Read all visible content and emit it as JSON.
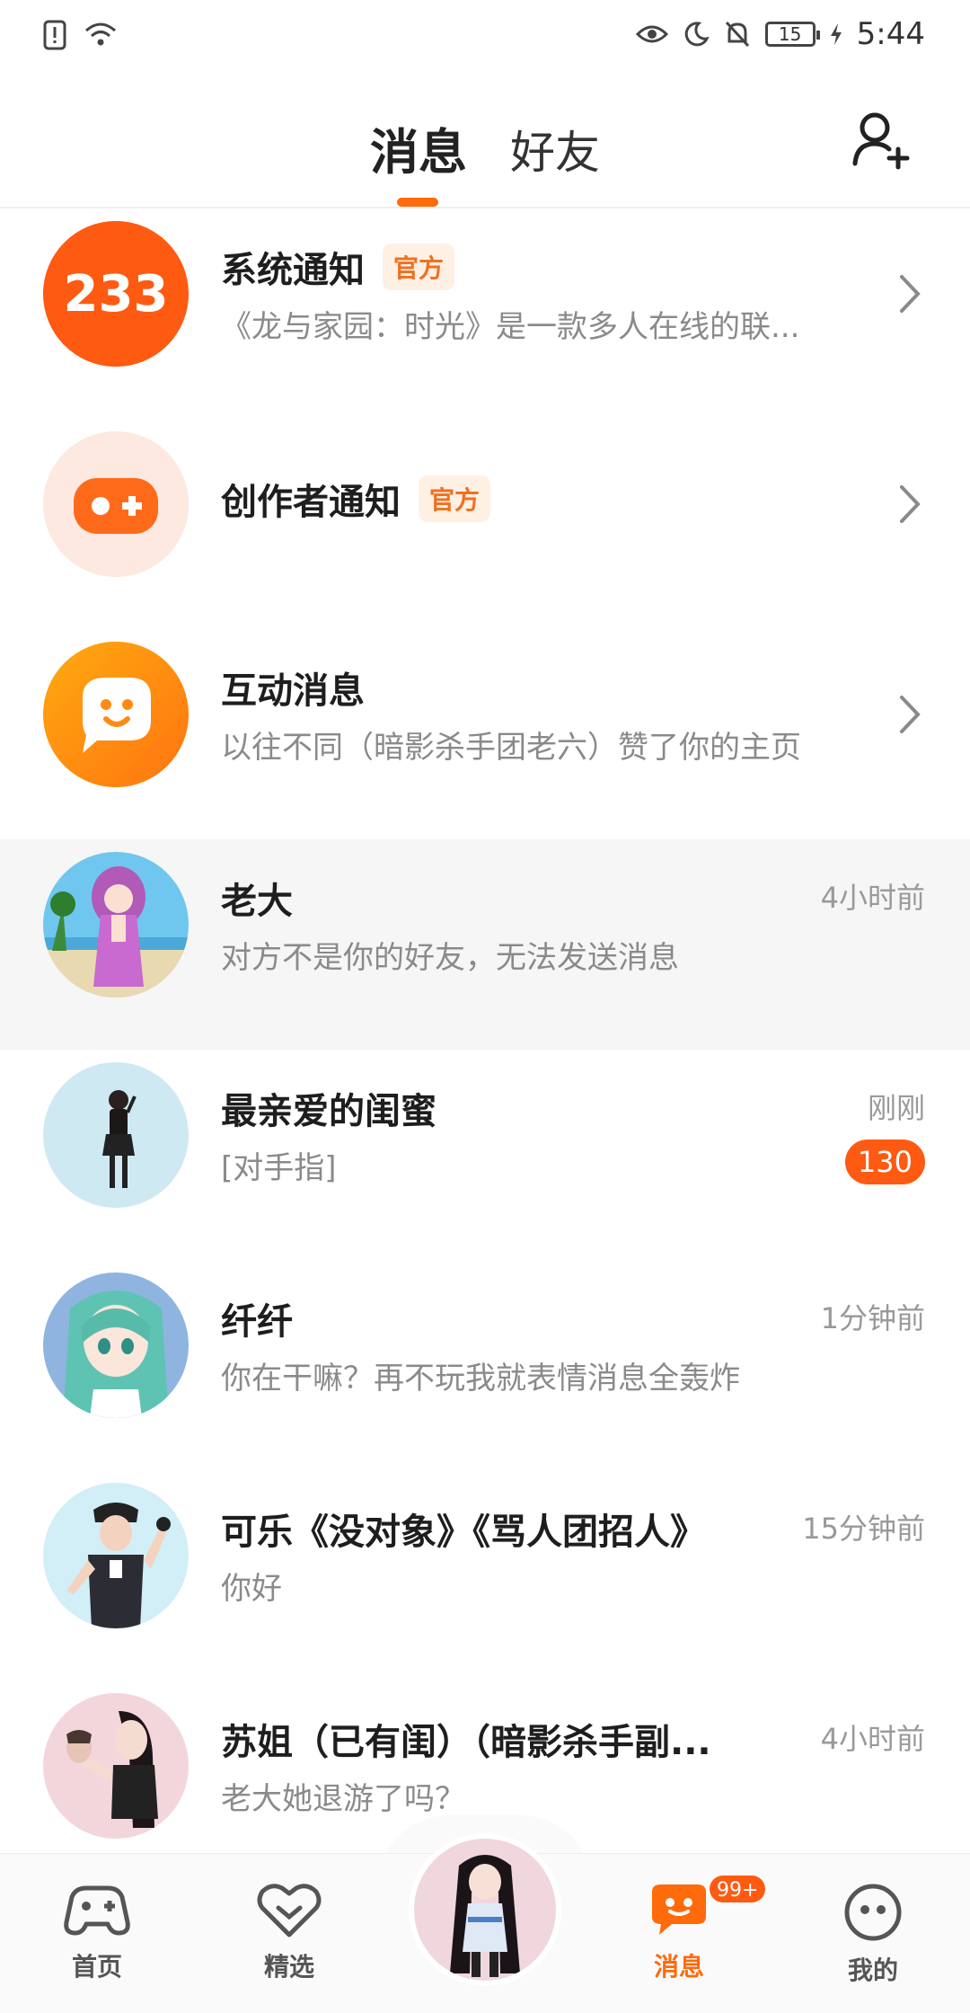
{
  "status_bar": {
    "time": "5:44",
    "battery": "15"
  },
  "header": {
    "tabs": [
      {
        "label": "消息",
        "active": true
      },
      {
        "label": "好友",
        "active": false
      }
    ]
  },
  "official_label": "官方",
  "messages": [
    {
      "title": "系统通知",
      "official": true,
      "preview": "《龙与家园：时光》是一款多人在线的联...",
      "time": "",
      "avatar": "233-logo-icon"
    },
    {
      "title": "创作者通知",
      "official": true,
      "preview": "",
      "time": "",
      "avatar": "gamepad-icon"
    },
    {
      "title": "互动消息",
      "official": false,
      "preview": "以往不同（暗影杀手团老六）赞了你的主页",
      "time": "",
      "avatar": "chat-face-icon"
    },
    {
      "title": "老大",
      "preview": "对方不是你的好友，无法发送消息",
      "time": "4小时前"
    },
    {
      "title": "最亲爱的闺蜜",
      "preview": "[对手指]",
      "time": "刚刚",
      "unread": "130"
    },
    {
      "title": "纤纤",
      "preview": "你在干嘛？再不玩我就表情消息全轰炸",
      "time": "1分钟前"
    },
    {
      "title": "可乐《没对象》《骂人团招人》",
      "preview": "你好",
      "time": "15分钟前"
    },
    {
      "title": "苏姐（已有闺）（暗影杀手副...",
      "preview": "老大她退游了吗？",
      "time": "4小时前"
    }
  ],
  "bottom_nav": {
    "items": [
      {
        "label": "首页",
        "icon": "gamepad-icon"
      },
      {
        "label": "精选",
        "icon": "heart-icon"
      },
      {
        "label": "消息",
        "icon": "chat-icon",
        "badge": "99+",
        "active": true
      },
      {
        "label": "我的",
        "icon": "face-icon"
      }
    ]
  },
  "colors": {
    "accent": "#ff6a0a",
    "badge": "#ff5a12"
  }
}
